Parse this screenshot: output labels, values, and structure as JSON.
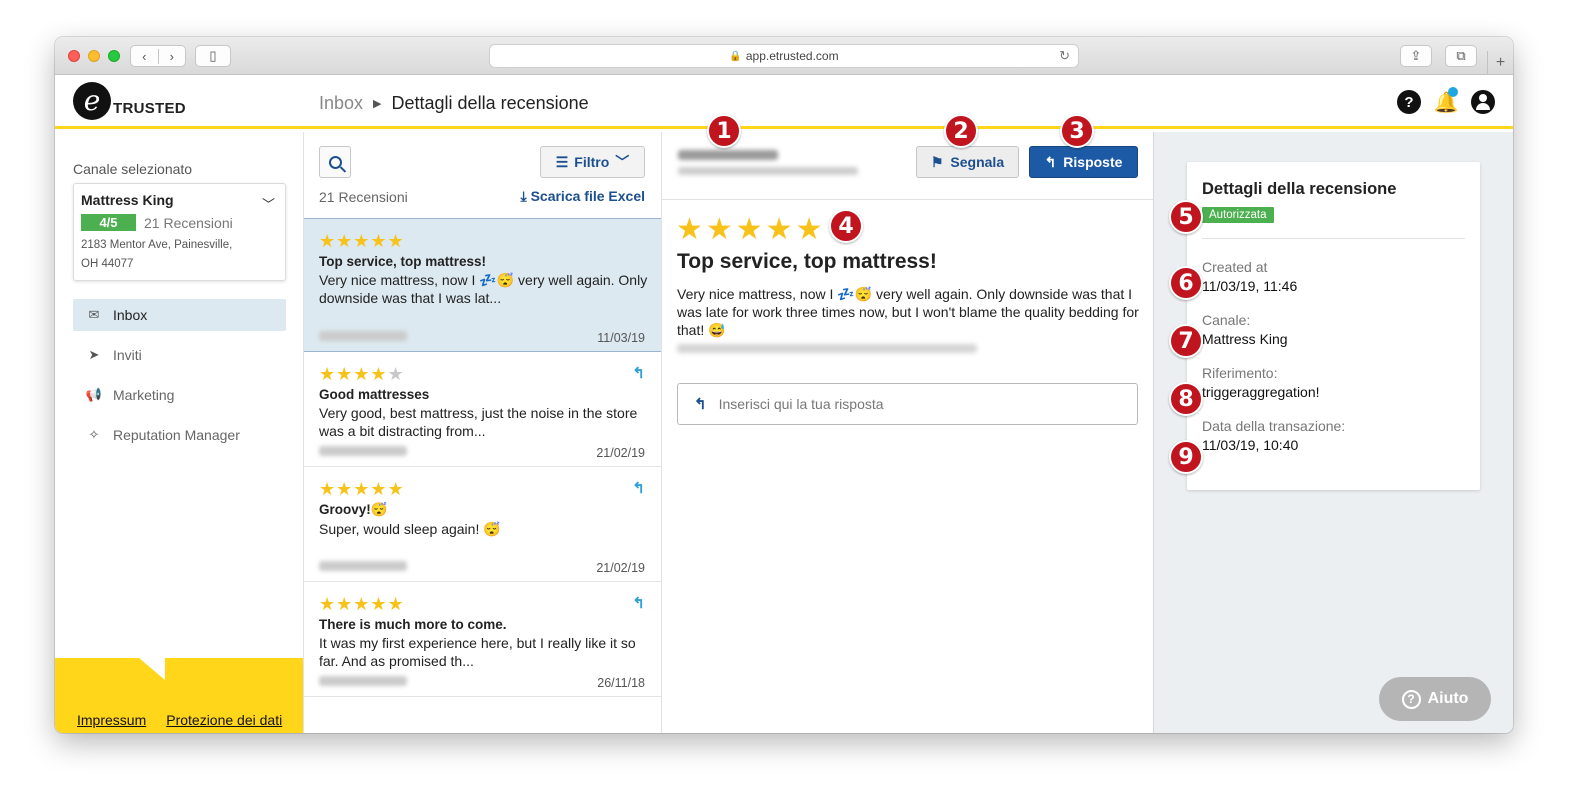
{
  "browser": {
    "url": "app.etrusted.com"
  },
  "header": {
    "logo_letter": "e",
    "logo_text": "TRUSTED",
    "breadcrumb": {
      "parent": "Inbox",
      "current": "Dettagli della recensione"
    },
    "help_icon_glyph": "?"
  },
  "sidebar": {
    "channel_label": "Canale selezionato",
    "channel": {
      "name": "Mattress King",
      "score": "4/5",
      "review_count": "21 Recensioni",
      "address": "2183 Mentor Ave, Painesville, OH 44077"
    },
    "items": [
      {
        "label": "Inbox",
        "icon": "inbox-icon",
        "active": true
      },
      {
        "label": "Inviti",
        "icon": "paper-plane-icon",
        "active": false
      },
      {
        "label": "Marketing",
        "icon": "megaphone-icon",
        "active": false
      },
      {
        "label": "Reputation Manager",
        "icon": "sparkle-icon",
        "active": false
      }
    ],
    "footer": {
      "impressum": "Impressum",
      "privacy": "Protezione dei dati"
    }
  },
  "review_list": {
    "filter_label": "Filtro",
    "count_label": "21 Recensioni",
    "excel_label": "Scarica file Excel",
    "items": [
      {
        "rating": 5,
        "title": "Top service, top mattress!",
        "excerpt": "Very nice mattress, now I 💤😴 very well again. Only downside was that I was lat...",
        "date": "11/03/19",
        "replied": false,
        "active": true
      },
      {
        "rating": 4,
        "title": "Good mattresses",
        "excerpt": "Very good, best mattress, just the noise in the store was a bit distracting from...",
        "date": "21/02/19",
        "replied": true,
        "active": false
      },
      {
        "rating": 5,
        "title": "Groovy!😴",
        "excerpt": "Super, would sleep again! 😴",
        "date": "21/02/19",
        "replied": true,
        "active": false
      },
      {
        "rating": 5,
        "title": "There is much more to come.",
        "excerpt": "It was my first experience here, but I really like it so far. And as promised th...",
        "date": "26/11/18",
        "replied": true,
        "active": false
      }
    ]
  },
  "detail": {
    "flag_label": "Segnala",
    "reply_label": "Risposte",
    "rating": 5,
    "title": "Top service, top mattress!",
    "body": "Very nice mattress, now I 💤😴 very well again. Only downside was that I was late for work three times now, but I won't blame the quality bedding for that! 😅",
    "reply_placeholder": "Inserisci qui la tua risposta"
  },
  "review_details": {
    "heading": "Dettagli della recensione",
    "status_badge": "Autorizzata",
    "rows": [
      {
        "label": "Created at",
        "value": "11/03/19, 11:46"
      },
      {
        "label": "Canale:",
        "value": "Mattress King"
      },
      {
        "label": "Riferimento:",
        "value": "triggeraggregation!"
      },
      {
        "label": "Data della transazione:",
        "value": "11/03/19, 10:40"
      }
    ]
  },
  "help_button": {
    "label": "Aiuto"
  },
  "markers": [
    "1",
    "2",
    "3",
    "4",
    "5",
    "6",
    "7",
    "8",
    "9"
  ],
  "colors": {
    "accent_yellow": "#ffd61a",
    "primary_blue": "#1d5aa5",
    "star_yellow": "#f7c21a",
    "badge_green": "#4caf50",
    "marker_red": "#c0141f",
    "active_row_bg": "#dde9f0"
  }
}
